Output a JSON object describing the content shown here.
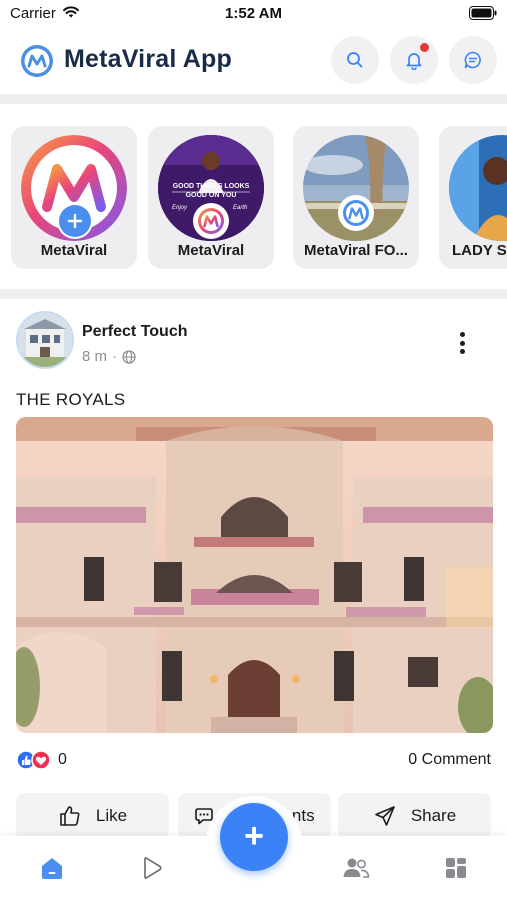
{
  "status_bar": {
    "carrier": "Carrier",
    "time": "1:52 AM"
  },
  "header": {
    "title": "MetaViral App",
    "has_notification": true,
    "accent": "#3b82f6",
    "title_color": "#1a2b48"
  },
  "stories": [
    {
      "label": "MetaViral",
      "kind": "create",
      "icon": "plus-icon"
    },
    {
      "label": "MetaViral",
      "kind": "story",
      "overlay_text": "GOOD THINGS LOOKS GOOD ON YOU",
      "overlay_left": "Enjoy",
      "overlay_right": "Earth"
    },
    {
      "label": "MetaViral FO...",
      "kind": "story"
    },
    {
      "label": "LADY SA",
      "kind": "story"
    }
  ],
  "post": {
    "author": "Perfect Touch",
    "time": "8 m",
    "separator": "·",
    "privacy_icon": "globe-icon",
    "caption": "THE ROYALS",
    "reaction_count": "0",
    "comment_count": "0 Comment",
    "actions": {
      "like": "Like",
      "comments": "Comments",
      "share": "Share"
    }
  },
  "nav": {
    "items": [
      "home-icon",
      "play-icon",
      "friends-icon",
      "grid-icon"
    ],
    "active": "home-icon",
    "fab_label": "+"
  }
}
